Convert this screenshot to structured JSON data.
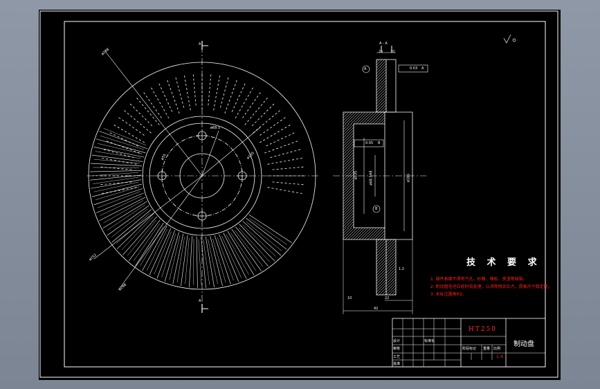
{
  "drawing": {
    "section_mark": "A",
    "section_label": "A - A",
    "datum": "A",
    "datum_b": "B",
    "roughness_symbol": "▽"
  },
  "front_view": {
    "dims": [
      "ø288",
      "ø68.5",
      "ø135",
      "ø55",
      "ø252"
    ]
  },
  "section_view": {
    "dims_top": [
      "25",
      "10"
    ],
    "tol_flatness": "0.03",
    "tol_runout": "0.05",
    "dims_vertical": [
      "ø68.5H8",
      "ø135",
      "ø185"
    ],
    "roughness": "1.2",
    "dims_bottom": [
      "10",
      "22",
      "42"
    ]
  },
  "tech_requirements": {
    "title": "技 术 要 求",
    "items": [
      "1. 铸件表面不得有气孔、砂眼、缩松、夹渣等缺陷。",
      "2. 制动盘毛坯应经时效处理，以消除残余应力，提高尺寸稳定性。",
      "3. 未标注圆角R3。"
    ]
  },
  "title_block": {
    "material": "HT250",
    "part_name": "制动盘",
    "scale": "1:4",
    "labels": [
      "设计",
      "标准化",
      "审核",
      "工艺",
      "批准",
      "阶段标记",
      "重量",
      "比例"
    ]
  }
}
